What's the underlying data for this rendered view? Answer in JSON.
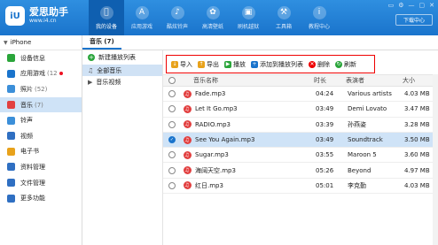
{
  "app": {
    "logo_mark": "iU",
    "name": "爱思助手",
    "url": "www.i4.cn"
  },
  "nav": [
    {
      "label": "我的设备",
      "icon": "apple-icon",
      "glyph": "",
      "active": true
    },
    {
      "label": "应用游戏",
      "icon": "apps-icon",
      "glyph": "A"
    },
    {
      "label": "酷炫铃声",
      "icon": "bell-icon",
      "glyph": "♪"
    },
    {
      "label": "高清壁纸",
      "icon": "flower-icon",
      "glyph": "✿"
    },
    {
      "label": "刷机越狱",
      "icon": "box-icon",
      "glyph": "▣"
    },
    {
      "label": "工具箱",
      "icon": "toolbox-icon",
      "glyph": "⚒"
    },
    {
      "label": "教程中心",
      "icon": "info-icon",
      "glyph": "i"
    }
  ],
  "window_controls": [
    "▭",
    "⚙",
    "—",
    "▢",
    "✕"
  ],
  "download_center": "下载中心",
  "device": {
    "name": "iPhone",
    "caret": "▼"
  },
  "sidebar": [
    {
      "label": "设备信息",
      "icon": "info-circle-icon",
      "color": "#2aa53a",
      "count": ""
    },
    {
      "label": "应用游戏",
      "icon": "apps-icon",
      "color": "#1a74cc",
      "count": "(12",
      "dot": true
    },
    {
      "label": "照片",
      "icon": "photo-icon",
      "color": "#3b8fd9",
      "count": "(52)"
    },
    {
      "label": "音乐",
      "icon": "music-icon",
      "color": "#e24040",
      "count": "(7)",
      "active": true
    },
    {
      "label": "铃声",
      "icon": "bell-icon",
      "color": "#3b8fd9",
      "count": ""
    },
    {
      "label": "视频",
      "icon": "video-icon",
      "color": "#2f6fc2",
      "count": ""
    },
    {
      "label": "电子书",
      "icon": "book-icon",
      "color": "#e8a21b",
      "count": ""
    },
    {
      "label": "资料管理",
      "icon": "contacts-icon",
      "color": "#2f6fc2",
      "count": ""
    },
    {
      "label": "文件管理",
      "icon": "folder-icon",
      "color": "#2f6fc2",
      "count": ""
    },
    {
      "label": "更多功能",
      "icon": "grid-icon",
      "color": "#2f6fc2",
      "count": ""
    }
  ],
  "tab": "音乐 (7)",
  "new_playlist": "新建播放列表",
  "playlists": [
    {
      "label": "全部音乐",
      "icon": "music-note-icon",
      "active": true
    },
    {
      "label": "音乐视频",
      "icon": "video-icon"
    }
  ],
  "toolbar": [
    {
      "label": "导入",
      "icon": "import-icon",
      "color": "#e8a21b",
      "glyph": "↓"
    },
    {
      "label": "导出",
      "icon": "export-icon",
      "color": "#e8a21b",
      "glyph": "↑"
    },
    {
      "label": "播放",
      "icon": "play-icon",
      "color": "#2aa53a",
      "glyph": "▶"
    },
    {
      "label": "添加到播放列表",
      "icon": "add-playlist-icon",
      "color": "#1a74cc",
      "glyph": "+"
    },
    {
      "label": "删除",
      "icon": "delete-icon",
      "color": "#e00",
      "glyph": "✕"
    },
    {
      "label": "刷新",
      "icon": "refresh-icon",
      "color": "#2aa53a",
      "glyph": "↻"
    }
  ],
  "table": {
    "headers": {
      "name": "音乐名称",
      "duration": "时长",
      "artist": "表演者",
      "size": "大小"
    },
    "rows": [
      {
        "name": "Fade.mp3",
        "duration": "04:24",
        "artist": "Various artists",
        "size": "4.03 MB"
      },
      {
        "name": "Let It Go.mp3",
        "duration": "03:49",
        "artist": "Demi Lovato",
        "size": "3.47 MB"
      },
      {
        "name": "RADIO.mp3",
        "duration": "03:39",
        "artist": "孙燕姿",
        "size": "3.28 MB"
      },
      {
        "name": "See You Again.mp3",
        "duration": "03:49",
        "artist": "Soundtrack",
        "size": "3.50 MB",
        "selected": true
      },
      {
        "name": "Sugar.mp3",
        "duration": "03:55",
        "artist": "Maroon 5",
        "size": "3.60 MB"
      },
      {
        "name": "海阔天空.mp3",
        "duration": "05:26",
        "artist": "Beyond",
        "size": "4.97 MB"
      },
      {
        "name": "红日.mp3",
        "duration": "05:01",
        "artist": "李克勤",
        "size": "4.03 MB"
      }
    ]
  }
}
